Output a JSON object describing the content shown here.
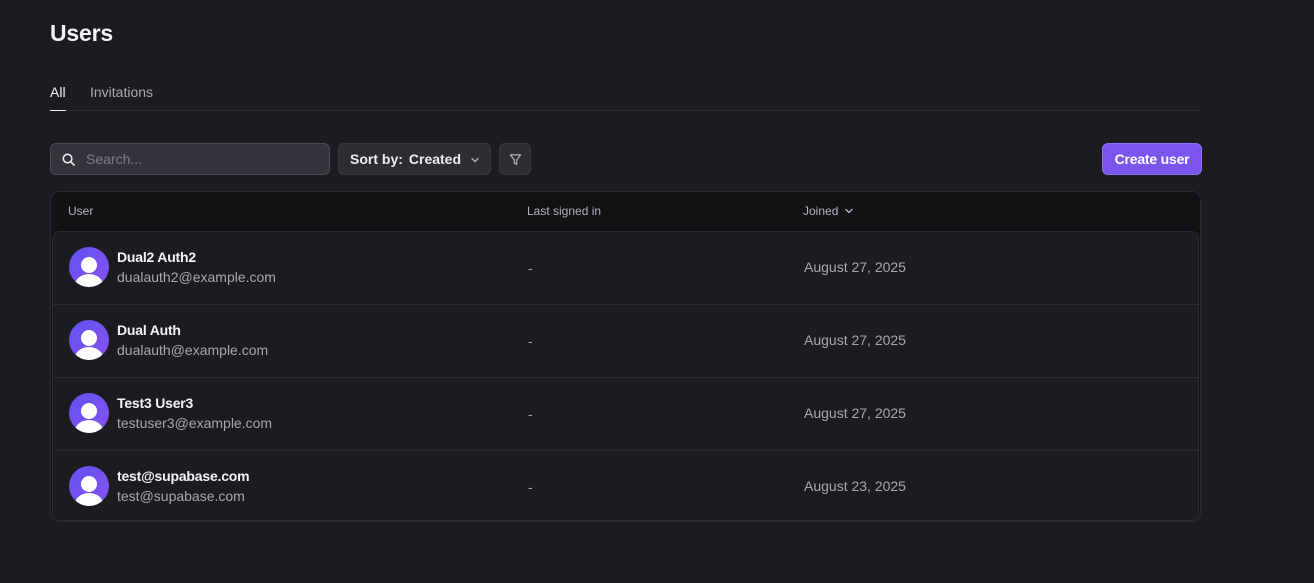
{
  "page": {
    "title": "Users"
  },
  "tabs": [
    {
      "label": "All",
      "active": true
    },
    {
      "label": "Invitations",
      "active": false
    }
  ],
  "toolbar": {
    "search": {
      "placeholder": "Search...",
      "value": "",
      "icon": "search-icon"
    },
    "sort": {
      "label": "Sort by:",
      "value": "Created",
      "icon": "chevron-down-icon"
    },
    "filter": {
      "icon": "filter-icon"
    },
    "create_label": "Create user"
  },
  "table": {
    "columns": [
      {
        "label": "User"
      },
      {
        "label": "Last signed in"
      },
      {
        "label": "Joined",
        "sort_icon": "chevron-down-icon"
      }
    ],
    "rows": [
      {
        "name": "Dual2 Auth2",
        "email": "dualauth2@example.com",
        "last_signed_in": "-",
        "joined": "August 27, 2025"
      },
      {
        "name": "Dual Auth",
        "email": "dualauth@example.com",
        "last_signed_in": "-",
        "joined": "August 27, 2025"
      },
      {
        "name": "Test3 User3",
        "email": "testuser3@example.com",
        "last_signed_in": "-",
        "joined": "August 27, 2025"
      },
      {
        "name": "test@supabase.com",
        "email": "test@supabase.com",
        "last_signed_in": "-",
        "joined": "August 23, 2025"
      }
    ]
  },
  "colors": {
    "background": "#1c1b20",
    "accent": "#7c55ee",
    "avatar_gradient": [
      "#5b55f0",
      "#8a4ff1"
    ]
  }
}
